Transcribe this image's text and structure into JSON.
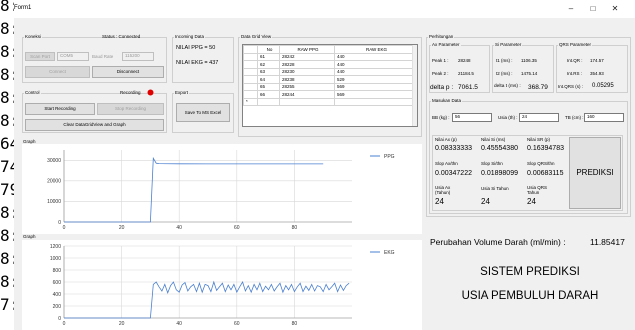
{
  "window": {
    "title": "Form1",
    "minimize": "–",
    "maximize": "□",
    "close": "✕"
  },
  "left_overlay": [
    "8:",
    "8:",
    "8:",
    "8:",
    "8:",
    "8:",
    "64",
    "74",
    "79",
    "8:",
    "8:",
    "8:",
    "8:",
    "7:"
  ],
  "koneksi": {
    "label": "Koneksi",
    "scan_port": "Scan Port",
    "com_value": "COM5",
    "baud_label": "Baud Rate",
    "baud_value": "115200",
    "status": "Status : Connected",
    "connect": "Connect",
    "disconnect": "Disconnect"
  },
  "control": {
    "label": "Control",
    "recording": "Recording",
    "start": "Start Recording",
    "stop": "Stop Recording",
    "clear": "Clear DataGridView and Graph",
    "recording_color": "#e00000"
  },
  "incoming": {
    "label": "Incoming Data",
    "ppg": "NILAI PPG = 50",
    "ekg": "NILAI EKG = 437"
  },
  "export": {
    "label": "Export",
    "button": "Save To MS Excel"
  },
  "grid": {
    "label": "Data Grid View",
    "headers": [
      "No",
      "RAW PPG",
      "RAW EKG"
    ],
    "rows": [
      [
        "61",
        "28242",
        "440"
      ],
      [
        "62",
        "28228",
        "440"
      ],
      [
        "63",
        "28230",
        "440"
      ],
      [
        "64",
        "28238",
        "529"
      ],
      [
        "65",
        "28255",
        "569"
      ],
      [
        "66",
        "28244",
        "569"
      ]
    ],
    "new_row_marker": "*"
  },
  "graph1": {
    "label": "Graph",
    "legend": "PPG",
    "yticks": [
      "30000",
      "20000",
      "10000",
      "0"
    ],
    "xticks": [
      "0",
      "20",
      "40",
      "60",
      "80"
    ]
  },
  "graph2": {
    "label": "Graph",
    "legend": "EKG",
    "yticks": [
      "1200",
      "1000",
      "800",
      "600",
      "400",
      "200",
      "0"
    ],
    "xticks": [
      "0",
      "20",
      "40",
      "60",
      "80"
    ]
  },
  "perhitungan": {
    "label": "Perhitungan",
    "ax_param": "Ax Parameter",
    "peak1": "Peak 1 :",
    "peak1_val": "28248",
    "peak2": "Peak 2 :",
    "peak2_val": "21184.5",
    "delta_p": "delta p :",
    "delta_p_val": "7061.5",
    "si_param": "Si Parameter",
    "t1": "t1 (ms) :",
    "t1_val": "1106.35",
    "t2": "t2 (ms) :",
    "t2_val": "1475.14",
    "delta_t": "delta t (ms) :",
    "delta_t_val": "368.79",
    "qrs_param": "QRS Parameter",
    "int_qr": "Int.QR :",
    "int_qr_val": "174.57",
    "int_rs": "Int.RS :",
    "int_rs_val": "354.93",
    "int_qrs": "Int.QRS (s) :",
    "int_qrs_val": "0.05295"
  },
  "masukan": {
    "label": "Masukan Data",
    "bb": "BB (kg) :",
    "bb_val": "56",
    "usia": "Usia (th) :",
    "usia_val": "24",
    "tb": "TB (cm) :",
    "tb_val": "160"
  },
  "nilai": {
    "ax_p": "Nilai Ax (p)",
    "ax_p_val": "0.08333333",
    "si_p": "Nilai Si (ms)",
    "si_p_val": "0.45554380",
    "sr_p": "Nilai SR (p)",
    "sr_p_val": "0.16394783",
    "ax_thn": "Slop Ax/thn",
    "ax_thn_val": "0.00347222",
    "si_thn": "Slop Si/thn",
    "si_thn_val": "0.01898099",
    "qrs_thn": "Slop QRS/thn",
    "qrs_thn_val": "0.00683115",
    "usia_ax": "Usia Ax",
    "usia_ax_sub": "(Tahun)",
    "usia_ax_val": "24",
    "usia_si": "Usia Si Tahun",
    "usia_si_val": "24",
    "usia_qrs": "Usia QRS",
    "usia_qrs_sub": "Tahun",
    "usia_qrs_val": "24",
    "prediksi": "PREDIKSI"
  },
  "volume": {
    "label": "Perubahan Volume Darah (ml/min) :",
    "value": "11.85417"
  },
  "sistem": {
    "line1": "SISTEM PREDIKSI",
    "line2": "USIA PEMBULUH DARAH"
  },
  "chart_data": [
    {
      "type": "line",
      "series": [
        {
          "name": "PPG",
          "color": "#4a7fd0",
          "x": [
            0,
            30,
            31,
            32,
            33,
            40,
            50,
            60,
            70,
            80,
            90
          ],
          "y": [
            0,
            0,
            31000,
            28600,
            28400,
            28300,
            28260,
            28250,
            28240,
            28235,
            28230
          ]
        }
      ],
      "xlim": [
        0,
        100
      ],
      "ylim": [
        0,
        35000
      ]
    },
    {
      "type": "line",
      "series": [
        {
          "name": "EKG",
          "color": "#4a7fd0",
          "x": [
            0,
            30,
            31,
            32,
            33,
            34,
            35,
            36,
            37,
            38,
            39,
            40,
            41,
            42,
            43,
            44,
            45,
            46,
            47,
            48,
            49,
            50,
            51,
            52,
            53,
            54,
            55,
            56,
            57,
            58,
            59,
            60,
            61,
            62,
            63,
            64,
            65,
            66,
            67,
            68,
            69,
            70,
            71,
            72,
            73,
            74,
            75,
            76,
            77,
            78,
            79,
            80,
            81,
            82,
            83,
            84,
            85,
            86,
            87,
            88,
            89,
            90,
            91,
            92,
            93,
            94,
            95,
            96,
            97,
            98,
            99
          ],
          "y": [
            0,
            0,
            560,
            600,
            520,
            450,
            560,
            420,
            540,
            600,
            470,
            430,
            550,
            590,
            450,
            520,
            560,
            440,
            580,
            430,
            560,
            540,
            440,
            600,
            460,
            520,
            580,
            440,
            550,
            470,
            560,
            430,
            520,
            600,
            450,
            540,
            430,
            560,
            470,
            580,
            440,
            530,
            470,
            560,
            450,
            520,
            580,
            430,
            540,
            470,
            560,
            440,
            520,
            580,
            440,
            530,
            460,
            560,
            450,
            540,
            520,
            440,
            560,
            470,
            520,
            580,
            440,
            550,
            460,
            540,
            580
          ]
        }
      ],
      "xlim": [
        0,
        100
      ],
      "ylim": [
        0,
        1200
      ]
    }
  ]
}
